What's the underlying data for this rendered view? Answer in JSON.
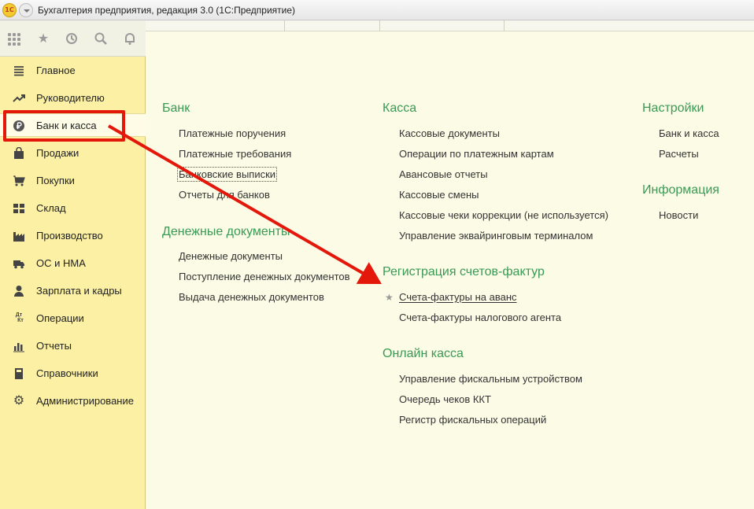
{
  "window": {
    "title": "Бухгалтерия предприятия, редакция 3.0  (1С:Предприятие)",
    "logo_text": "1С"
  },
  "toolbar": {
    "icons": [
      "apps-grid-icon",
      "favorites-star-icon",
      "history-icon",
      "search-icon",
      "notifications-bell-icon"
    ]
  },
  "sidebar": {
    "items": [
      {
        "label": "Главное",
        "icon": "menu-lines-icon"
      },
      {
        "label": "Руководителю",
        "icon": "trend-icon"
      },
      {
        "label": "Банк и касса",
        "icon": "ruble-coin-icon"
      },
      {
        "label": "Продажи",
        "icon": "shopping-bag-icon"
      },
      {
        "label": "Покупки",
        "icon": "cart-icon"
      },
      {
        "label": "Склад",
        "icon": "warehouse-icon"
      },
      {
        "label": "Производство",
        "icon": "factory-icon"
      },
      {
        "label": "ОС и НМА",
        "icon": "truck-icon"
      },
      {
        "label": "Зарплата и кадры",
        "icon": "person-icon"
      },
      {
        "label": "Операции",
        "icon": "dt-kt-icon"
      },
      {
        "label": "Отчеты",
        "icon": "bar-chart-icon"
      },
      {
        "label": "Справочники",
        "icon": "book-icon"
      },
      {
        "label": "Администрирование",
        "icon": "gear-icon"
      }
    ],
    "active_index": 2
  },
  "content": {
    "bank": {
      "title": "Банк",
      "links": [
        "Платежные поручения",
        "Платежные требования",
        "Банковские выписки",
        "Отчеты для банков"
      ]
    },
    "money_docs": {
      "title": "Денежные документы",
      "links": [
        "Денежные документы",
        "Поступление денежных документов",
        "Выдача денежных документов"
      ]
    },
    "kassa": {
      "title": "Касса",
      "links": [
        "Кассовые документы",
        "Операции по платежным картам",
        "Авансовые отчеты",
        "Кассовые смены",
        "Кассовые чеки коррекции (не используется)",
        "Управление эквайринговым терминалом"
      ]
    },
    "invoices": {
      "title": "Регистрация счетов-фактур",
      "links": [
        "Счета-фактуры на аванс",
        "Счета-фактуры налогового агента"
      ]
    },
    "online_kassa": {
      "title": "Онлайн касса",
      "links": [
        "Управление фискальным устройством",
        "Очередь чеков ККТ",
        "Регистр фискальных операций"
      ]
    },
    "settings": {
      "title": "Настройки",
      "links": [
        "Банк и касса",
        "Расчеты"
      ]
    },
    "info": {
      "title": "Информация",
      "links": [
        "Новости"
      ]
    }
  },
  "annotation_color": "#e3170a",
  "accent_green": "#3a9a55",
  "sidebar_bg": "#fbf0a3"
}
